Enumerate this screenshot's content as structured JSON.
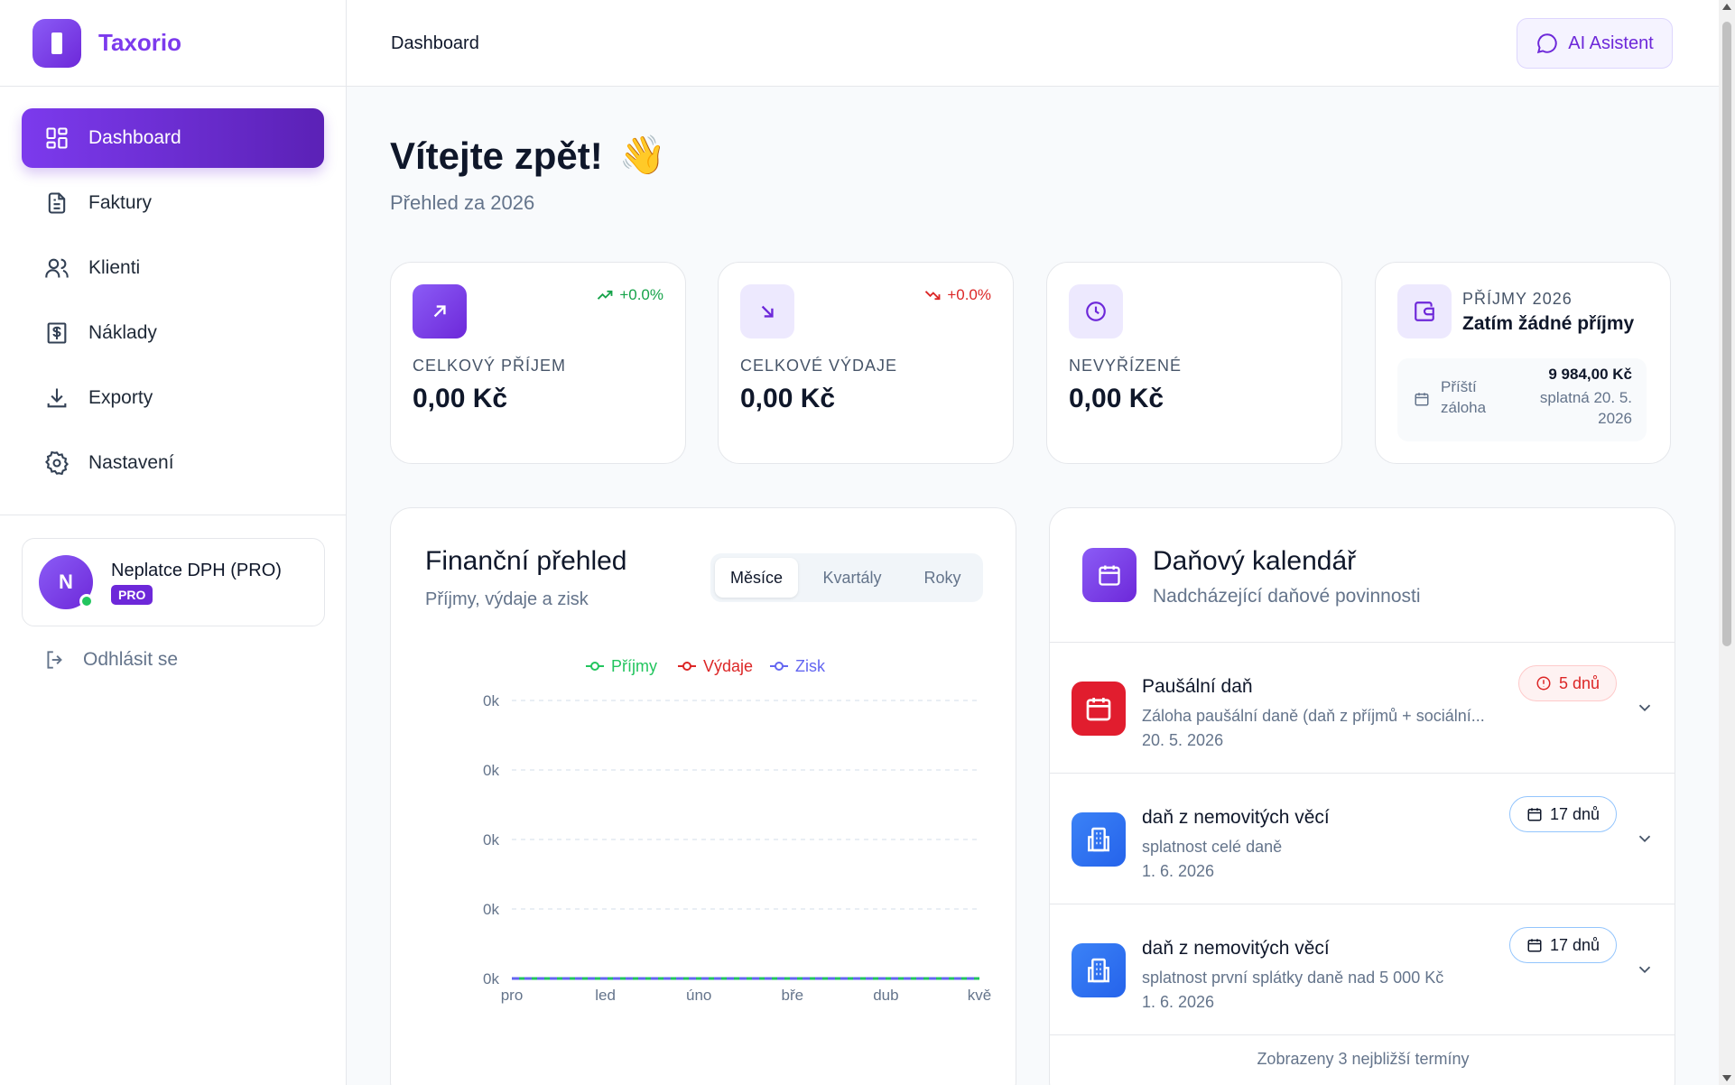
{
  "brand": {
    "name": "Taxorio"
  },
  "sidebar": {
    "items": [
      {
        "label": "Dashboard",
        "icon": "grid-icon",
        "active": true
      },
      {
        "label": "Faktury",
        "icon": "document-icon"
      },
      {
        "label": "Klienti",
        "icon": "users-icon"
      },
      {
        "label": "Náklady",
        "icon": "receipt-dollar-icon"
      },
      {
        "label": "Exporty",
        "icon": "download-icon"
      },
      {
        "label": "Nastavení",
        "icon": "gear-icon"
      }
    ],
    "user": {
      "initial": "N",
      "name": "Neplatce DPH (PRO)",
      "badge": "PRO"
    },
    "logout_label": "Odhlásit se"
  },
  "topbar": {
    "title": "Dashboard",
    "ai_label": "AI Asistent"
  },
  "welcome": {
    "title": "Vítejte zpět!",
    "emoji": "👋",
    "subtitle": "Přehled za 2026"
  },
  "stats": [
    {
      "label": "CELKOVÝ PŘÍJEM",
      "value": "0,00 Kč",
      "trend": "+0.0%",
      "trend_dir": "up"
    },
    {
      "label": "CELKOVÉ VÝDAJE",
      "value": "0,00 Kč",
      "trend": "+0.0%",
      "trend_dir": "down"
    },
    {
      "label": "NEVYŘÍZENÉ",
      "value": "0,00 Kč"
    }
  ],
  "income": {
    "label": "PŘÍJMY 2026",
    "title": "Zatím žádné příjmy",
    "next_label": "Příští záloha",
    "next_amount": "9 984,00 Kč",
    "next_date": "splatná 20. 5. 2026"
  },
  "chart": {
    "title": "Finanční přehled",
    "subtitle": "Příjmy, výdaje a zisk",
    "tabs": [
      "Měsíce",
      "Kvartály",
      "Roky"
    ],
    "active_tab": 0
  },
  "chart_data": {
    "type": "line",
    "categories": [
      "pro",
      "led",
      "úno",
      "bře",
      "dub",
      "kvě"
    ],
    "series": [
      {
        "name": "Příjmy",
        "values": [
          0,
          0,
          0,
          0,
          0,
          0
        ],
        "color": "#22c55e"
      },
      {
        "name": "Výdaje",
        "values": [
          0,
          0,
          0,
          0,
          0,
          0
        ],
        "color": "#dc2626"
      },
      {
        "name": "Zisk",
        "values": [
          0,
          0,
          0,
          0,
          0,
          0
        ],
        "color": "#6366f1"
      }
    ],
    "yticks": [
      "0k",
      "0k",
      "0k",
      "0k",
      "0k"
    ],
    "ylim": [
      0,
      4
    ],
    "grid": true,
    "legend": "top-center"
  },
  "calendar": {
    "title": "Daňový kalendář",
    "subtitle": "Nadcházející daňové povinnosti",
    "items": [
      {
        "name": "Paušální daň",
        "desc": "Záloha paušální daně (daň z příjmů + sociální...",
        "date": "20. 5. 2026",
        "badge": "5 dnů",
        "tone": "red",
        "icon": "calendar-icon"
      },
      {
        "name": "daň z nemovitých věcí",
        "desc": "splatnost celé daně",
        "date": "1. 6. 2026",
        "badge": "17 dnů",
        "tone": "blue",
        "icon": "building-icon"
      },
      {
        "name": "daň z nemovitých věcí",
        "desc": "splatnost první splátky daně nad 5 000 Kč",
        "date": "1. 6. 2026",
        "badge": "17 dnů",
        "tone": "blue",
        "icon": "building-icon"
      }
    ],
    "footer": "Zobrazeny 3 nejbližší termíny"
  }
}
